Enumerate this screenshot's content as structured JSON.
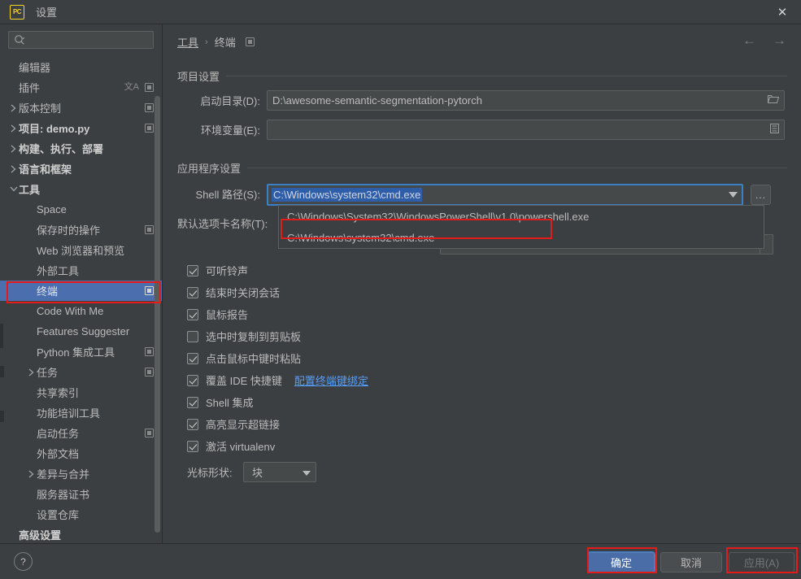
{
  "window": {
    "app_icon": "pycharm-logo-icon",
    "title": "设置",
    "close_label": "✕"
  },
  "sidebar": {
    "search": {
      "placeholder": "",
      "value": ""
    },
    "items": [
      {
        "label": "编辑器",
        "indent": 0,
        "arrow": "none",
        "bold": false,
        "trail": []
      },
      {
        "label": "插件",
        "indent": 0,
        "arrow": "none",
        "bold": false,
        "trail": [
          "lang",
          "mini"
        ]
      },
      {
        "label": "版本控制",
        "indent": 0,
        "arrow": "collapsed",
        "bold": false,
        "trail": [
          "mini"
        ]
      },
      {
        "label": "项目: demo.py",
        "indent": 0,
        "arrow": "collapsed",
        "bold": true,
        "trail": [
          "mini"
        ]
      },
      {
        "label": "构建、执行、部署",
        "indent": 0,
        "arrow": "collapsed",
        "bold": true,
        "trail": []
      },
      {
        "label": "语言和框架",
        "indent": 0,
        "arrow": "collapsed",
        "bold": true,
        "trail": []
      },
      {
        "label": "工具",
        "indent": 0,
        "arrow": "expanded",
        "bold": true,
        "trail": []
      },
      {
        "label": "Space",
        "indent": 1,
        "arrow": "none",
        "bold": false,
        "trail": []
      },
      {
        "label": "保存时的操作",
        "indent": 1,
        "arrow": "none",
        "bold": false,
        "trail": [
          "mini"
        ]
      },
      {
        "label": "Web 浏览器和预览",
        "indent": 1,
        "arrow": "none",
        "bold": false,
        "trail": []
      },
      {
        "label": "外部工具",
        "indent": 1,
        "arrow": "none",
        "bold": false,
        "trail": []
      },
      {
        "label": "终端",
        "indent": 1,
        "arrow": "none",
        "bold": false,
        "trail": [
          "mini"
        ],
        "selected": true
      },
      {
        "label": "Code With Me",
        "indent": 1,
        "arrow": "none",
        "bold": false,
        "trail": []
      },
      {
        "label": "Features Suggester",
        "indent": 1,
        "arrow": "none",
        "bold": false,
        "trail": []
      },
      {
        "label": "Python 集成工具",
        "indent": 1,
        "arrow": "none",
        "bold": false,
        "trail": [
          "mini"
        ]
      },
      {
        "label": "任务",
        "indent": 1,
        "arrow": "collapsed",
        "bold": false,
        "trail": [
          "mini"
        ]
      },
      {
        "label": "共享索引",
        "indent": 1,
        "arrow": "none",
        "bold": false,
        "trail": []
      },
      {
        "label": "功能培训工具",
        "indent": 1,
        "arrow": "none",
        "bold": false,
        "trail": []
      },
      {
        "label": "启动任务",
        "indent": 1,
        "arrow": "none",
        "bold": false,
        "trail": [
          "mini"
        ]
      },
      {
        "label": "外部文档",
        "indent": 1,
        "arrow": "none",
        "bold": false,
        "trail": []
      },
      {
        "label": "差异与合并",
        "indent": 1,
        "arrow": "collapsed",
        "bold": false,
        "trail": []
      },
      {
        "label": "服务器证书",
        "indent": 1,
        "arrow": "none",
        "bold": false,
        "trail": []
      },
      {
        "label": "设置仓库",
        "indent": 1,
        "arrow": "none",
        "bold": false,
        "trail": []
      },
      {
        "label": "高级设置",
        "indent": 0,
        "arrow": "none",
        "bold": true,
        "trail": []
      }
    ]
  },
  "breadcrumb": {
    "root": "工具",
    "separator": "›",
    "current": "终端",
    "trailing_icon": "mini-panel-icon",
    "back_icon": "←",
    "forward_icon": "→"
  },
  "project_settings": {
    "section_title": "项目设置",
    "start_dir": {
      "label": "启动目录(D):",
      "value": "D:\\awesome-semantic-segmentation-pytorch",
      "icon": "folder-icon"
    },
    "env_vars": {
      "label": "环境变量(E):",
      "value": "",
      "icon": "list-icon"
    }
  },
  "app_settings": {
    "section_title": "应用程序设置",
    "shell_path": {
      "label": "Shell 路径(S):",
      "value": "C:\\Windows\\system32\\cmd.exe",
      "browse_label": "..."
    },
    "dropdown": {
      "options": [
        "C:\\Windows\\System32\\WindowsPowerShell\\v1.0\\powershell.exe",
        "C:\\Windows\\system32\\cmd.exe"
      ],
      "highlighted_index": 1
    },
    "tab_name": {
      "label": "默认选项卡名称(T):",
      "value": ""
    },
    "checkboxes": [
      {
        "label": "可听铃声",
        "checked": true
      },
      {
        "label": "结束时关闭会话",
        "checked": true
      },
      {
        "label": "鼠标报告",
        "checked": true
      },
      {
        "label": "选中时复制到剪贴板",
        "checked": false
      },
      {
        "label": "点击鼠标中键时粘贴",
        "checked": true
      },
      {
        "label": "覆盖 IDE 快捷键",
        "checked": true,
        "link": "配置终端键绑定"
      },
      {
        "label": "Shell 集成",
        "checked": true
      },
      {
        "label": "高亮显示超链接",
        "checked": true
      },
      {
        "label": "激活 virtualenv",
        "checked": true
      }
    ],
    "cursor_shape": {
      "label": "光标形状:",
      "value": "块"
    }
  },
  "footer": {
    "help_label": "?",
    "ok_label": "确定",
    "cancel_label": "取消",
    "apply_label": "应用(A)"
  },
  "colors": {
    "accent_blue": "#4b6eaf",
    "annotation_red": "#e41b1b",
    "link_blue": "#589df6",
    "panel_bg": "#3c3f41",
    "field_bg": "#45494a"
  }
}
